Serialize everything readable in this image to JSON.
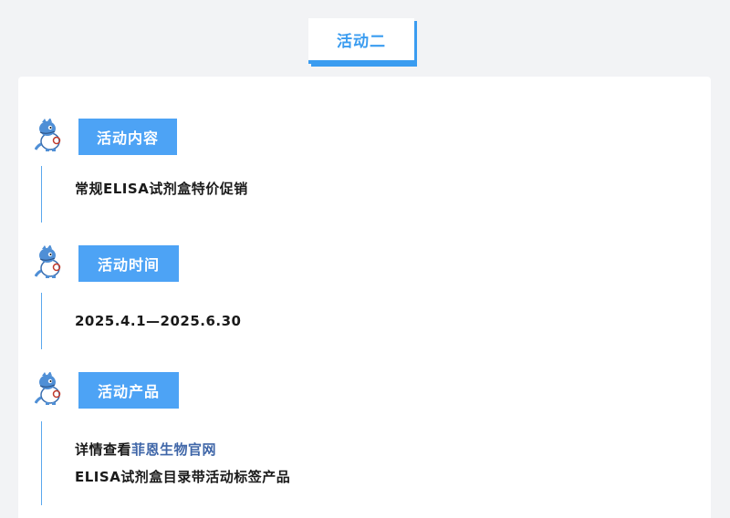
{
  "page": {
    "title": "活动二"
  },
  "sections": [
    {
      "label": "活动内容",
      "lines": [
        "常规ELISA试剂盒特价促销"
      ]
    },
    {
      "label": "活动时间",
      "lines": [
        "2025.4.1—2025.6.30"
      ]
    },
    {
      "label": "活动产品",
      "line1_prefix": "详情查看",
      "line1_link": "菲恩生物官网",
      "line2": "ELISA试剂盒目录带活动标签产品"
    }
  ],
  "icons": {
    "mascot": "dinosaur-doctor-mascot-icon"
  },
  "colors": {
    "accent": "#3a9cf0",
    "label_bg": "#4da3f5",
    "link": "#3f66a8",
    "background": "#f2f3f5"
  }
}
